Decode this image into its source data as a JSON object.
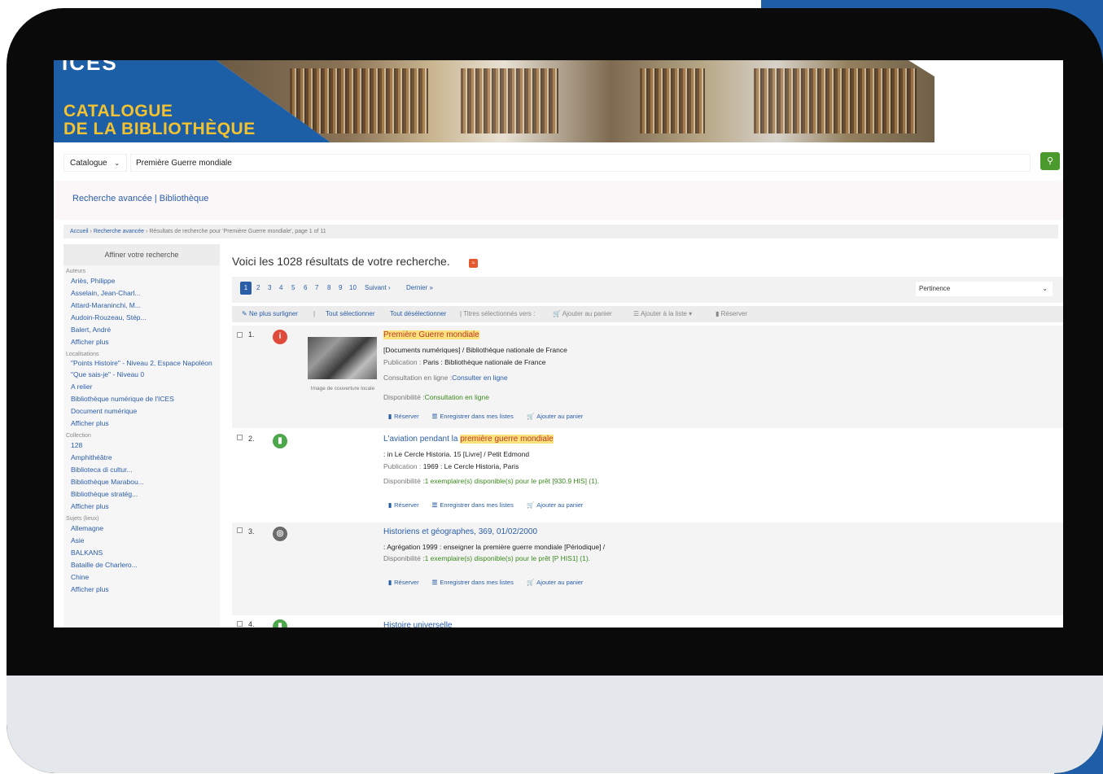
{
  "banner": {
    "logo": "ICES",
    "title_line1": "CATALOGUE",
    "title_line2": "DE LA BIBLIOTHÈQUE"
  },
  "search": {
    "scope": "Catalogue",
    "query": "Première Guerre mondiale",
    "search_icon": "search-icon"
  },
  "links": {
    "advanced": "Recherche avancée | Bibliothèque"
  },
  "breadcrumb": {
    "home": "Accueil",
    "advanced": "Recherche avancée",
    "current": "Résultats de recherche pour 'Première Guerre mondiale', page 1 of 11"
  },
  "sidebar": {
    "heading": "Affiner votre recherche",
    "facets": [
      {
        "title": "Auteurs",
        "items": [
          "Ariès, Philippe",
          "Asselain, Jean-Charl...",
          "Attard-Maraninchi, M...",
          "Audoin-Rouzeau, Stép...",
          "Balert, André",
          "Afficher plus"
        ]
      },
      {
        "title": "Localisations",
        "items": [
          "\"Points Histoire\" - Niveau 2, Espace Napoléon",
          "\"Que sais-je\" - Niveau 0",
          "A relier",
          "Bibliothèque numérique de l'ICES",
          "Document numérique",
          "Afficher plus"
        ]
      },
      {
        "title": "Collection",
        "items": [
          "128",
          "Amphithéâtre",
          "Biblioteca di cultur...",
          "Bibliothèque Marabou...",
          "Bibliothèque stratég...",
          "Afficher plus"
        ]
      },
      {
        "title": "Sujets (lieux)",
        "items": [
          "Allemagne",
          "Asie",
          "BALKANS",
          "Bataille de Charlero...",
          "Chine",
          "Afficher plus"
        ]
      }
    ]
  },
  "results": {
    "heading": "Voici les 1028 résultats de votre recherche.",
    "pages": [
      "1",
      "2",
      "3",
      "4",
      "5",
      "6",
      "7",
      "8",
      "9",
      "10"
    ],
    "next": "Suivant ›",
    "last": "Dernier »",
    "sort": "Pertinence",
    "toolbar": {
      "unhighlight": "Ne plus surligner",
      "select_all": "Tout sélectionner",
      "deselect_all": "Tout désélectionner",
      "selected_to": "| Titres sélectionnés vers :",
      "add_cart": "Ajouter au panier",
      "add_list": "Ajouter à la liste",
      "reserve": "Réserver"
    },
    "actions": {
      "reserve": "Réserver",
      "save_lists": "Enregistrer dans mes listes",
      "add_cart": "Ajouter au panier"
    },
    "records": [
      {
        "num": "1.",
        "title_hl": "Première Guerre mondiale",
        "line1": "[Documents numériques] / Bibliothèque nationale de France",
        "pub_label": "Publication :",
        "pub": "Paris : Bibliothèque nationale de France",
        "online_label": "Consultation en ligne :",
        "online": "Consulter en ligne",
        "avail_label": "Disponibilité :",
        "avail": "Consultation en ligne",
        "cover_caption": "Image de couverture locale"
      },
      {
        "num": "2.",
        "title_pre": "L'aviation pendant la ",
        "title_hl": "première guerre mondiale",
        "line1": ": in Le Cercle Historia. 15 [Livre] / Petit Edmond",
        "pub_label": "Publication :",
        "pub": "1969 : Le Cercle Historia, Paris",
        "avail_label": "Disponibilité :",
        "avail": "1 exemplaire(s) disponible(s) pour le prêt [930.9 HIS] (1)."
      },
      {
        "num": "3.",
        "title": "Historiens et géographes, 369, 01/02/2000",
        "line1": ": Agrégation 1999 : enseigner la première guerre mondiale [Périodique] /",
        "avail_label": "Disponibilité :",
        "avail": "1 exemplaire(s) disponible(s) pour le prêt [P HIS1] (1)."
      },
      {
        "num": "4.",
        "title": "Histoire universelle"
      }
    ]
  },
  "colors": {
    "brand_blue": "#1d5fa6",
    "brand_yellow": "#f2c230",
    "link": "#2a5da8",
    "available": "#3a8a1e",
    "search_button": "#4a9a2e"
  }
}
